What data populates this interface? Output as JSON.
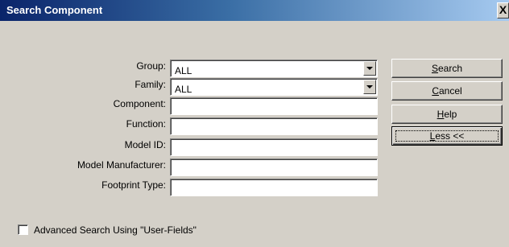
{
  "window": {
    "title": "Search Component",
    "close_label": "X"
  },
  "form": {
    "group": {
      "label": "Group:",
      "value": "ALL"
    },
    "family": {
      "label": "Family:",
      "value": "ALL"
    },
    "component": {
      "label": "Component:",
      "value": ""
    },
    "function": {
      "label": "Function:",
      "value": ""
    },
    "model_id": {
      "label": "Model ID:",
      "value": ""
    },
    "model_manufacturer": {
      "label": "Model Manufacturer:",
      "value": ""
    },
    "footprint_type": {
      "label": "Footprint Type:",
      "value": ""
    }
  },
  "buttons": {
    "search": {
      "mnemonic": "S",
      "rest": "earch"
    },
    "cancel": {
      "mnemonic": "C",
      "rest": "ancel"
    },
    "help": {
      "mnemonic": "H",
      "rest": "elp"
    },
    "less": {
      "mnemonic": "L",
      "rest": "ess <<"
    }
  },
  "advanced": {
    "label": "Advanced Search Using \"User-Fields\"",
    "checked": false
  }
}
